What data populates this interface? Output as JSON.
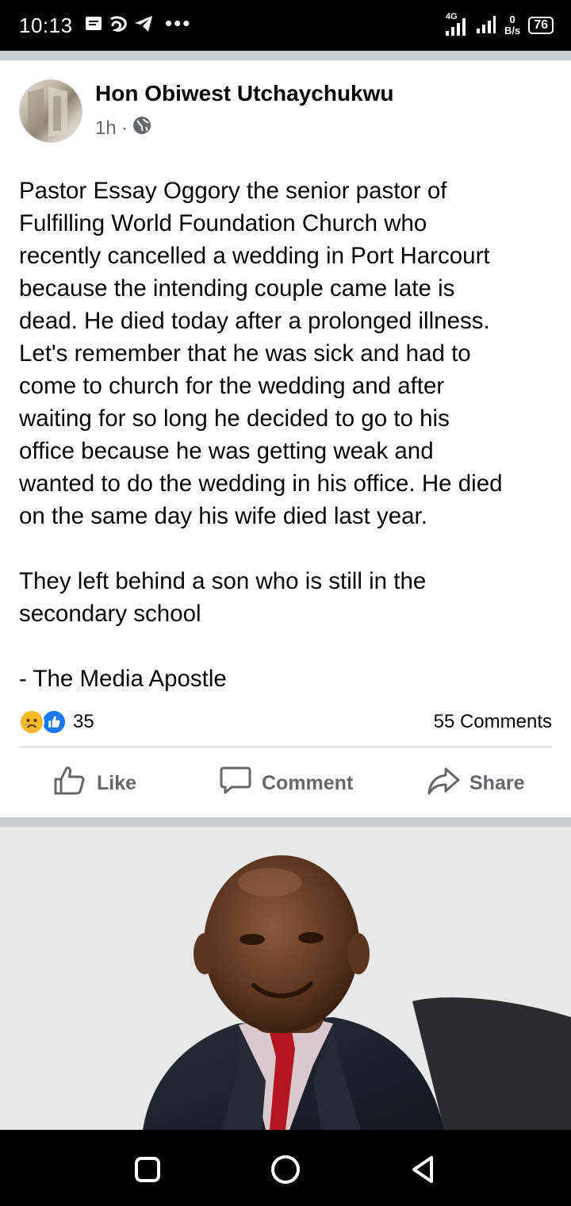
{
  "status_bar": {
    "time": "10:13",
    "icons": [
      "message-icon",
      "swirl-app-icon",
      "telegram-icon"
    ],
    "more": "•••",
    "network": "4G",
    "speed_value": "0",
    "speed_unit": "B/s",
    "battery": "76"
  },
  "post": {
    "author": "Hon Obiwest Utchaychukwu",
    "time": "1h",
    "separator": "·",
    "audience_icon": "globe-icon",
    "paragraphs": [
      "Pastor Essay Oggory the senior pastor of\nFulfilling World Foundation Church who\nrecently cancelled a wedding in Port Harcourt\nbecause the intending couple came late is\ndead. He died today after a prolonged illness.\nLet's remember that he was sick and had to\ncome to church for the wedding and after\nwaiting for so long he decided to go to his\noffice because he was getting weak and\nwanted to do the wedding in his office. He died\non the same day his wife died last year.",
      "They left behind a son who is still in the\nsecondary school",
      "- The Media Apostle"
    ],
    "reaction_count": "35",
    "comments": "55 Comments",
    "actions": {
      "like": "Like",
      "comment": "Comment",
      "share": "Share"
    }
  },
  "colors": {
    "text": "#050505",
    "secondary": "#65676b",
    "like_blue": "#1877f2",
    "sad_yellow": "#f7b928",
    "divider": "#c9ccd1"
  }
}
